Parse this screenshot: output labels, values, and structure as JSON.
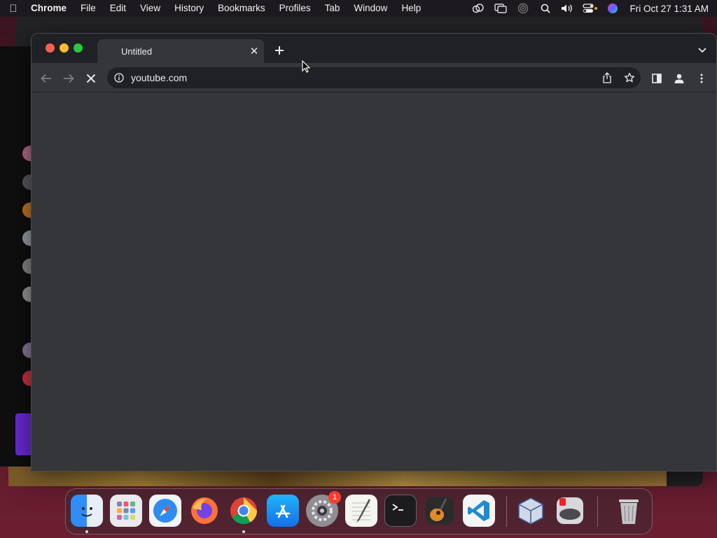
{
  "menubar": {
    "apple_glyph": "",
    "app_name": "Chrome",
    "items": [
      "File",
      "Edit",
      "View",
      "History",
      "Bookmarks",
      "Profiles",
      "Tab",
      "Window",
      "Help"
    ],
    "status_icons": [
      "creative-cloud-icon",
      "screen-mirroring-icon",
      "airplay-icon",
      "spotlight-search-icon",
      "volume-icon",
      "control-center-icon",
      "siri-icon"
    ],
    "clock": "Fri Oct 27  1:31 AM"
  },
  "browser": {
    "tab_title": "Untitled",
    "tab_close_glyph": "✕",
    "new_tab_glyph": "+",
    "url": "youtube.com",
    "state": "loading"
  },
  "dock": {
    "apps": [
      {
        "name": "finder",
        "running": true
      },
      {
        "name": "launchpad",
        "running": false
      },
      {
        "name": "safari",
        "running": false
      },
      {
        "name": "firefox",
        "running": false
      },
      {
        "name": "chrome",
        "running": true
      },
      {
        "name": "app-store",
        "running": false
      },
      {
        "name": "system-settings",
        "running": false,
        "badge": "1"
      },
      {
        "name": "textedit",
        "running": false
      },
      {
        "name": "terminal",
        "running": false
      },
      {
        "name": "garageband",
        "running": false
      },
      {
        "name": "vscode",
        "running": false
      },
      {
        "name": "virtualbox",
        "running": false
      },
      {
        "name": "parallels",
        "running": false
      },
      {
        "name": "trash",
        "running": false
      }
    ]
  },
  "colors": {
    "chrome_frame": "#202124",
    "chrome_toolbar": "#35363a",
    "omnibox": "#202124",
    "close": "#ff5f57",
    "minimize": "#febc2e",
    "maximize": "#28c840",
    "badge": "#ff3b30"
  }
}
